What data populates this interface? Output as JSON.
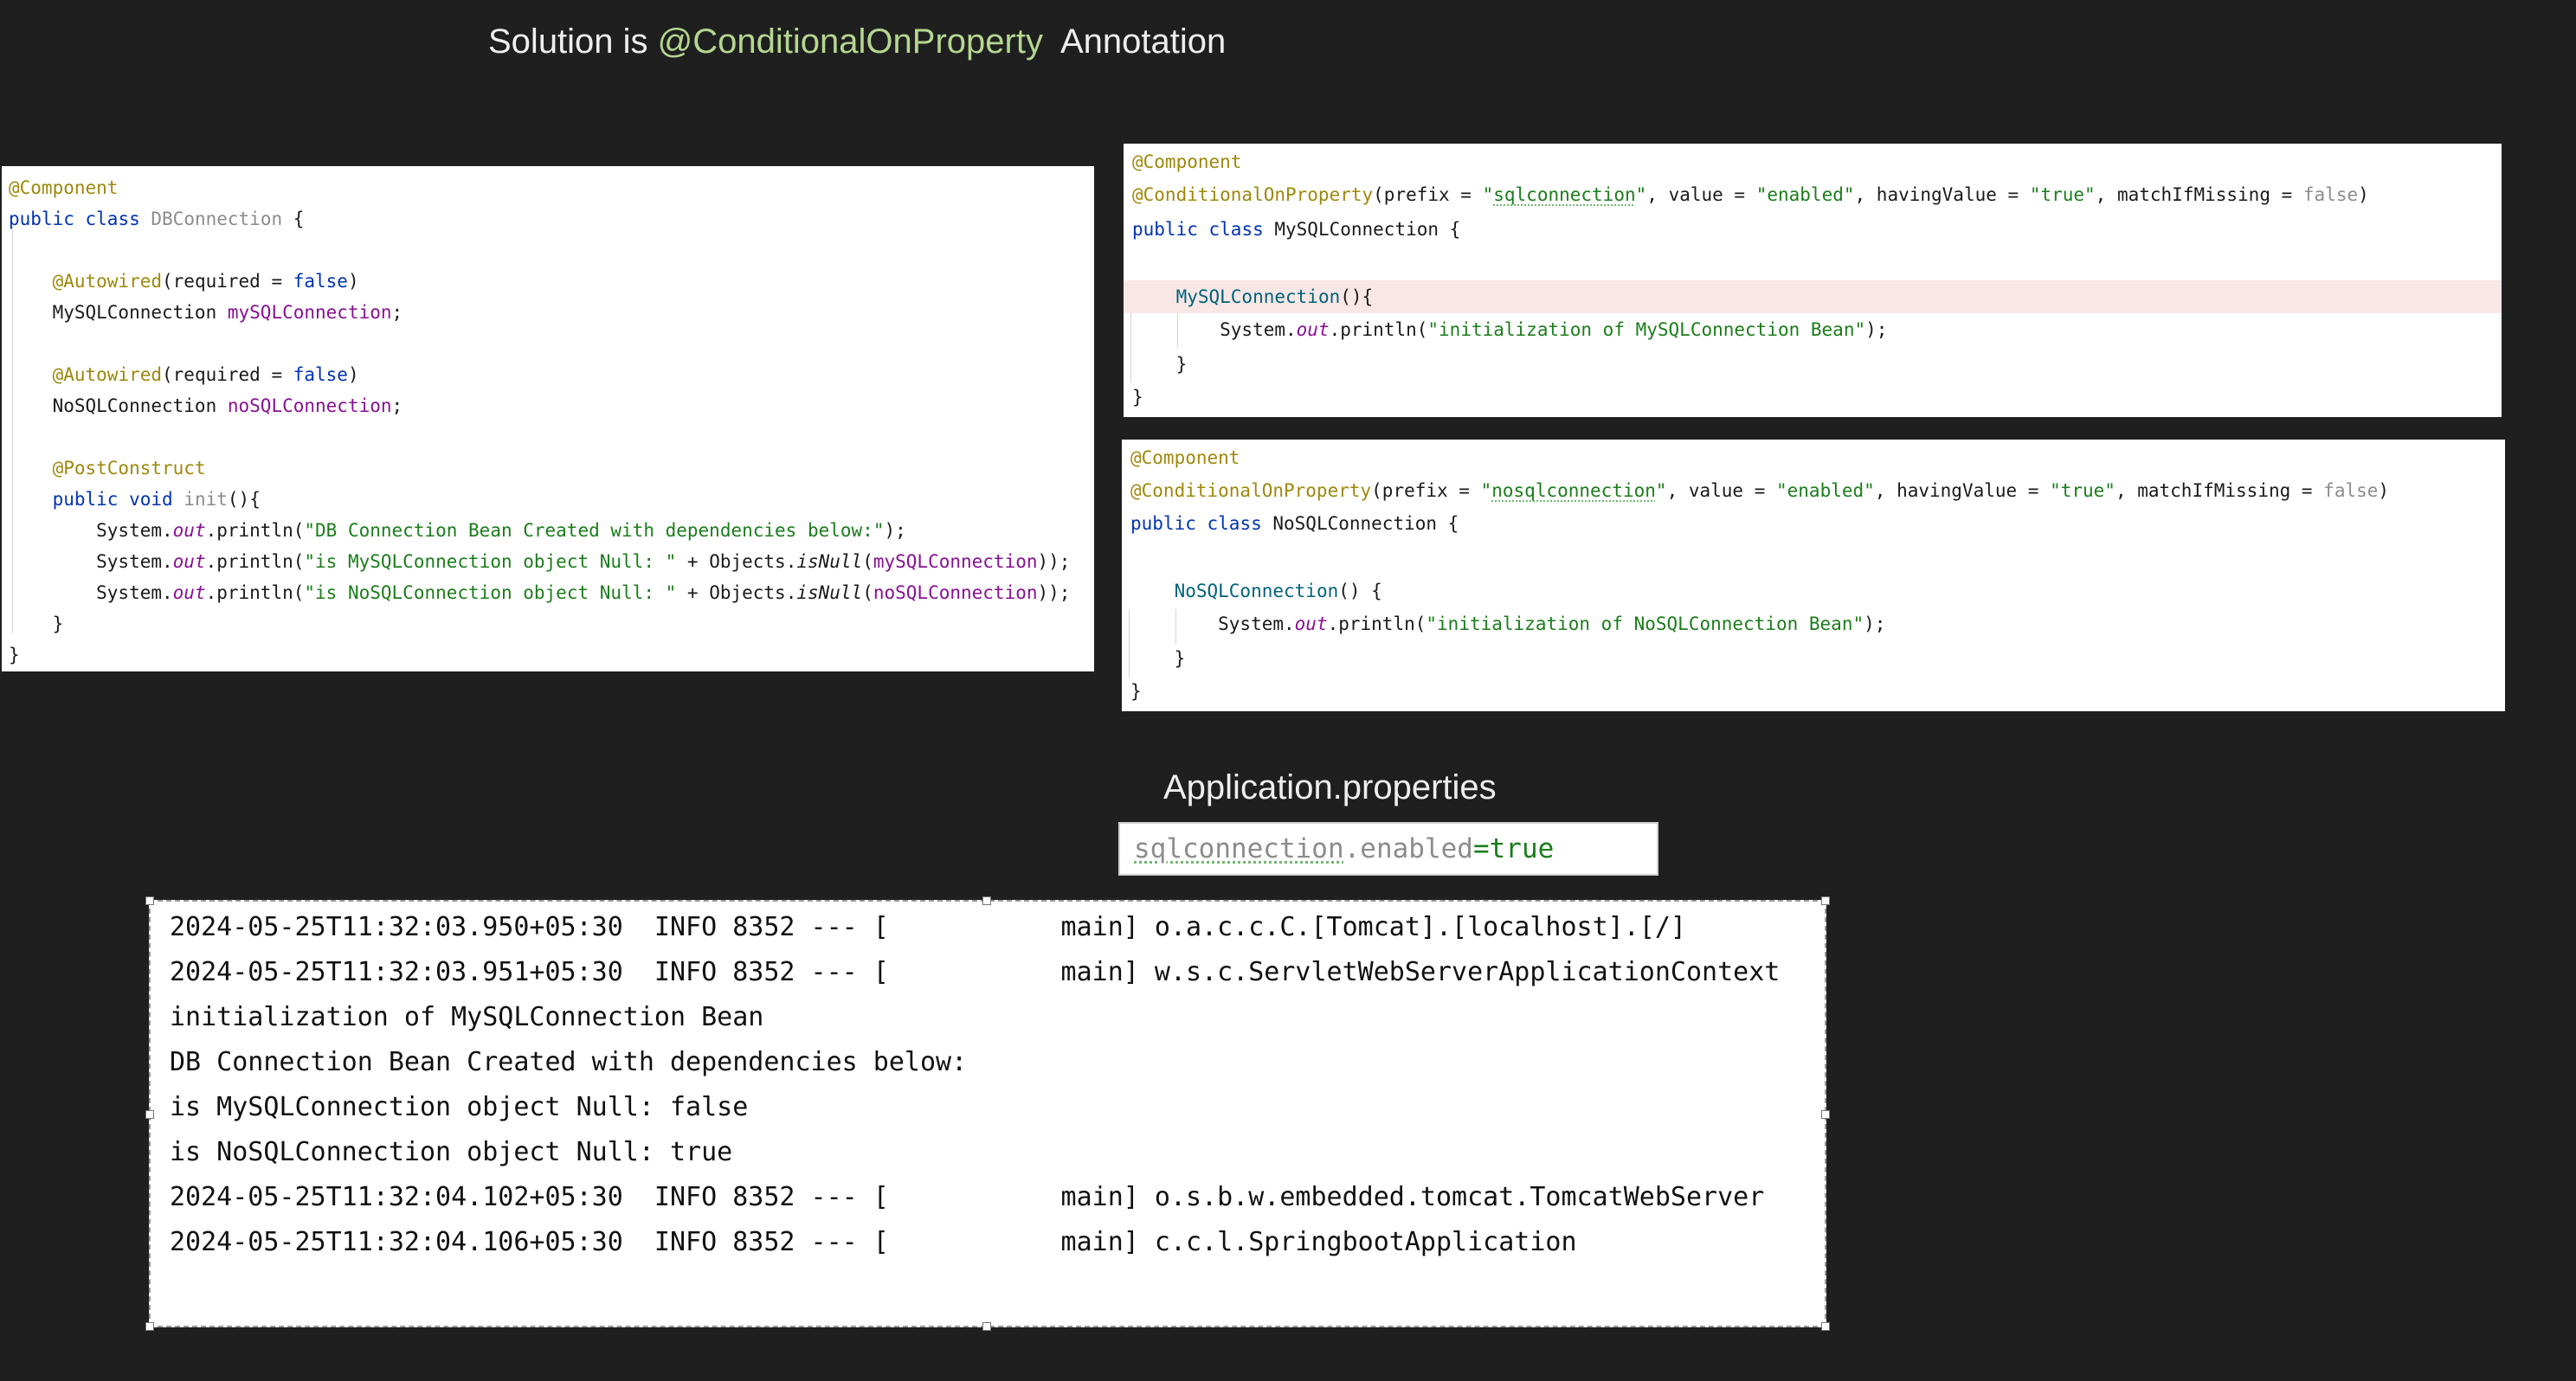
{
  "title": {
    "prefix": "Solution is ",
    "annotation": "@ConditionalOnProperty",
    "suffix": "  Annotation"
  },
  "db_connection_code": {
    "lines": [
      "@Component",
      "public class DBConnection {",
      "",
      "    @Autowired(required = false)",
      "    MySQLConnection mySQLConnection;",
      "",
      "    @Autowired(required = false)",
      "    NoSQLConnection noSQLConnection;",
      "",
      "    @PostConstruct",
      "    public void init(){",
      "        System.out.println(\"DB Connection Bean Created with dependencies below:\");",
      "        System.out.println(\"is MySQLConnection object Null: \" + Objects.isNull(mySQLConnection));",
      "        System.out.println(\"is NoSQLConnection object Null: \" + Objects.isNull(noSQLConnection));",
      "    }",
      "}"
    ]
  },
  "mysql_connection_code": {
    "lines": [
      "@Component",
      "@ConditionalOnProperty(prefix = \"sqlconnection\", value = \"enabled\", havingValue = \"true\", matchIfMissing = false)",
      "public class MySQLConnection {",
      "",
      "    MySQLConnection(){",
      "        System.out.println(\"initialization of MySQLConnection Bean\");",
      "    }",
      "}"
    ]
  },
  "nosql_connection_code": {
    "lines": [
      "@Component",
      "@ConditionalOnProperty(prefix = \"nosqlconnection\", value = \"enabled\", havingValue = \"true\", matchIfMissing = false)",
      "public class NoSQLConnection {",
      "",
      "    NoSQLConnection() {",
      "        System.out.println(\"initialization of NoSQLConnection Bean\");",
      "    }",
      "}"
    ]
  },
  "properties": {
    "title": "Application.properties",
    "prop_prefix": "sqlconnection",
    "prop_dot_key": ".enabled",
    "prop_equals": "=",
    "prop_value": "true"
  },
  "console": {
    "lines": [
      "2024-05-25T11:32:03.950+05:30  INFO 8352 --- [           main] o.a.c.c.C.[Tomcat].[localhost].[/]",
      "2024-05-25T11:32:03.951+05:30  INFO 8352 --- [           main] w.s.c.ServletWebServerApplicationContext",
      "initialization of MySQLConnection Bean",
      "DB Connection Bean Created with dependencies below:",
      "is MySQLConnection object Null: false",
      "is NoSQLConnection object Null: true",
      "2024-05-25T11:32:04.102+05:30  INFO 8352 --- [           main] o.s.b.w.embedded.tomcat.TomcatWebServer",
      "2024-05-25T11:32:04.106+05:30  INFO 8352 --- [           main] c.c.l.SpringbootApplication"
    ]
  }
}
